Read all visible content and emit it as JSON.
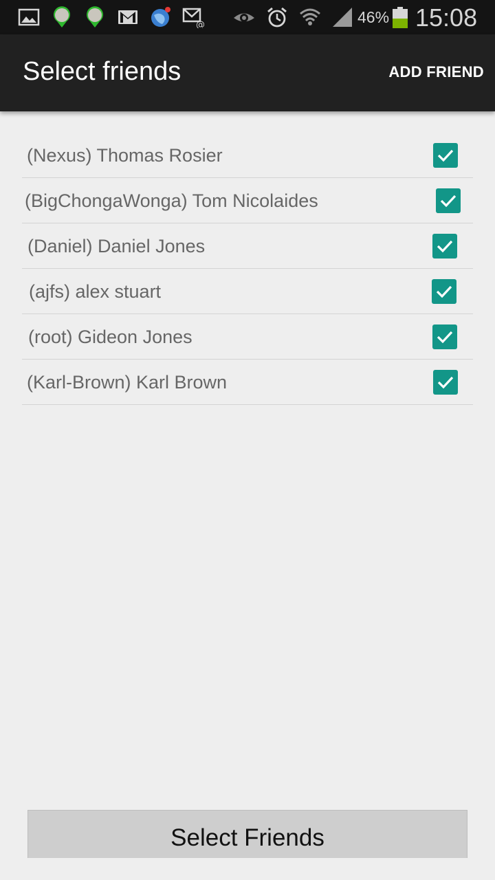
{
  "status_bar": {
    "battery_percent": "46%",
    "time": "15:08",
    "icons": [
      "gallery-icon",
      "maps-icon",
      "maps-icon",
      "gmail-icon",
      "browser-icon",
      "email-icon",
      "eye-icon",
      "alarm-icon",
      "wifi-icon",
      "signal-icon",
      "battery-icon"
    ]
  },
  "action_bar": {
    "title": "Select friends",
    "add_friend_label": "ADD FRIEND"
  },
  "friends": [
    {
      "label": "(Nexus) Thomas Rosier",
      "checked": true
    },
    {
      "label": "(BigChongaWonga) Tom Nicolaides",
      "checked": true
    },
    {
      "label": "(Daniel) Daniel Jones",
      "checked": true
    },
    {
      "label": "(ajfs) alex stuart",
      "checked": true
    },
    {
      "label": "(root) Gideon Jones",
      "checked": true
    },
    {
      "label": "(Karl-Brown) Karl Brown",
      "checked": true
    }
  ],
  "bottom_button": {
    "label": "Select Friends"
  },
  "colors": {
    "checkbox": "#129688",
    "action_bar": "#212121",
    "status_bar": "#141414",
    "background": "#eeeeee"
  }
}
